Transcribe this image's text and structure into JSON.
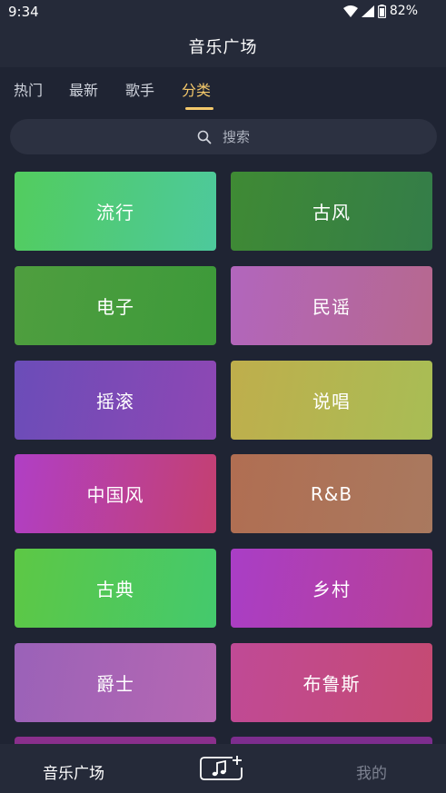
{
  "status_bar": {
    "time": "9:34",
    "battery": "82%"
  },
  "header": {
    "title": "音乐广场"
  },
  "tabs": [
    {
      "label": "热门",
      "active": false
    },
    {
      "label": "最新",
      "active": false
    },
    {
      "label": "歌手",
      "active": false
    },
    {
      "label": "分类",
      "active": true
    }
  ],
  "search": {
    "placeholder": "搜索"
  },
  "categories": [
    {
      "label": "流行",
      "colors": [
        "#52cc5e",
        "#4dc99c"
      ]
    },
    {
      "label": "古风",
      "colors": [
        "#3f8a34",
        "#347d49"
      ]
    },
    {
      "label": "电子",
      "colors": [
        "#4f9e3f",
        "#3d9a3a"
      ]
    },
    {
      "label": "民谣",
      "colors": [
        "#b266bd",
        "#b6688e"
      ]
    },
    {
      "label": "摇滚",
      "colors": [
        "#6b4db8",
        "#8e47b4"
      ]
    },
    {
      "label": "说唱",
      "colors": [
        "#bfae4c",
        "#a8bd55"
      ]
    },
    {
      "label": "中国风",
      "colors": [
        "#b03fc5",
        "#c44070"
      ]
    },
    {
      "label": "R&B",
      "colors": [
        "#b06e52",
        "#a9795f"
      ]
    },
    {
      "label": "古典",
      "colors": [
        "#5dc845",
        "#44c96d"
      ]
    },
    {
      "label": "乡村",
      "colors": [
        "#a93ec6",
        "#b84096"
      ]
    },
    {
      "label": "爵士",
      "colors": [
        "#9a62b8",
        "#b667b2"
      ]
    },
    {
      "label": "布鲁斯",
      "colors": [
        "#c04a96",
        "#c54a72"
      ]
    },
    {
      "label": "",
      "colors": [
        "#8a2f8c",
        "#8a2f8c"
      ]
    },
    {
      "label": "",
      "colors": [
        "#7d2d8e",
        "#7d2d8e"
      ]
    }
  ],
  "bottom_nav": {
    "home": "音乐广场",
    "mine": "我的"
  },
  "icons": {
    "search": "search-icon",
    "add_music": "add-music-icon",
    "wifi": "wifi-icon",
    "signal": "signal-icon",
    "battery": "battery-icon"
  }
}
